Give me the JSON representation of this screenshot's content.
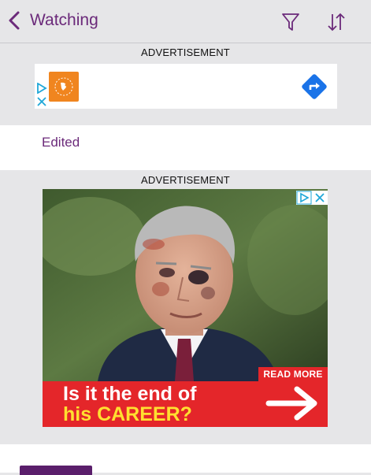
{
  "header": {
    "title": "Watching",
    "icons": [
      "chevron-left-icon",
      "filter-icon",
      "sort-icon"
    ],
    "accent_color": "#6b2a7a"
  },
  "ads": {
    "label": "ADVERTISEMENT",
    "banner": {
      "logo_color": "#f0851f",
      "nav_color": "#1a73e8"
    },
    "display": {
      "cta": "READ MORE",
      "headline_line1": "Is it the end of",
      "headline_line2": "his CAREER?",
      "band_color": "#e4262a",
      "highlight_color": "#ffe030"
    }
  },
  "list": {
    "items": [
      {
        "label": "Edited"
      }
    ]
  }
}
